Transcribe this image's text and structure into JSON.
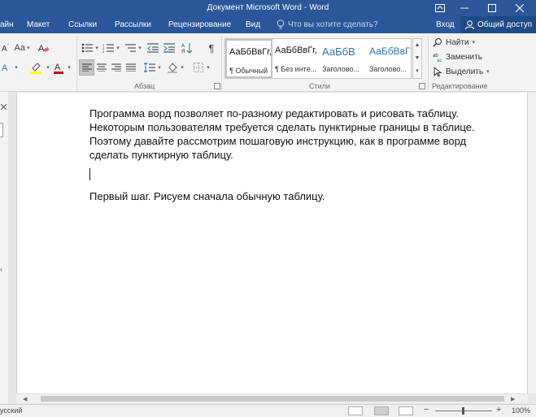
{
  "window": {
    "title": "Документ Microsoft Word - Word"
  },
  "tabs": {
    "items": [
      {
        "label": "айн"
      },
      {
        "label": "Макет"
      },
      {
        "label": "Ссылки"
      },
      {
        "label": "Рассылки"
      },
      {
        "label": "Рецензирование"
      },
      {
        "label": "Вид"
      }
    ],
    "tellme_placeholder": "Что вы хотите сделать?",
    "signin": "Вход",
    "share": "Общий доступ"
  },
  "ribbon": {
    "paragraph_group": "Абзац",
    "styles_group": "Стили",
    "editing_group": "Редактирование",
    "font_case_label": "Aa",
    "pilcrow": "¶",
    "styles": [
      {
        "sample": "АаБбВвГг,",
        "name": "¶ Обычный"
      },
      {
        "sample": "АаБбВвГг,",
        "name": "¶ Без инте..."
      },
      {
        "sample": "АаБбВ",
        "name": "Заголово..."
      },
      {
        "sample": "АаБбВвГ",
        "name": "Заголово..."
      }
    ],
    "editing": {
      "find": "Найти",
      "replace": "Заменить",
      "select": "Выделить"
    }
  },
  "document": {
    "paragraph1": "Программа ворд позволяет по-разному редактировать и рисовать таблицу. Некоторым пользователям требуется сделать пунктирные границы в таблице. Поэтому давайте рассмотрим пошаговую инструкцию, как в программе ворд сделать пунктирную таблицу.",
    "paragraph2": "Первый шаг. Рисуем сначала обычную таблицу."
  },
  "statusbar": {
    "language": "усский",
    "zoom": "100%"
  },
  "colors": {
    "brand": "#2b579a",
    "highlight": "#ffff00",
    "font_color": "#c00000"
  }
}
